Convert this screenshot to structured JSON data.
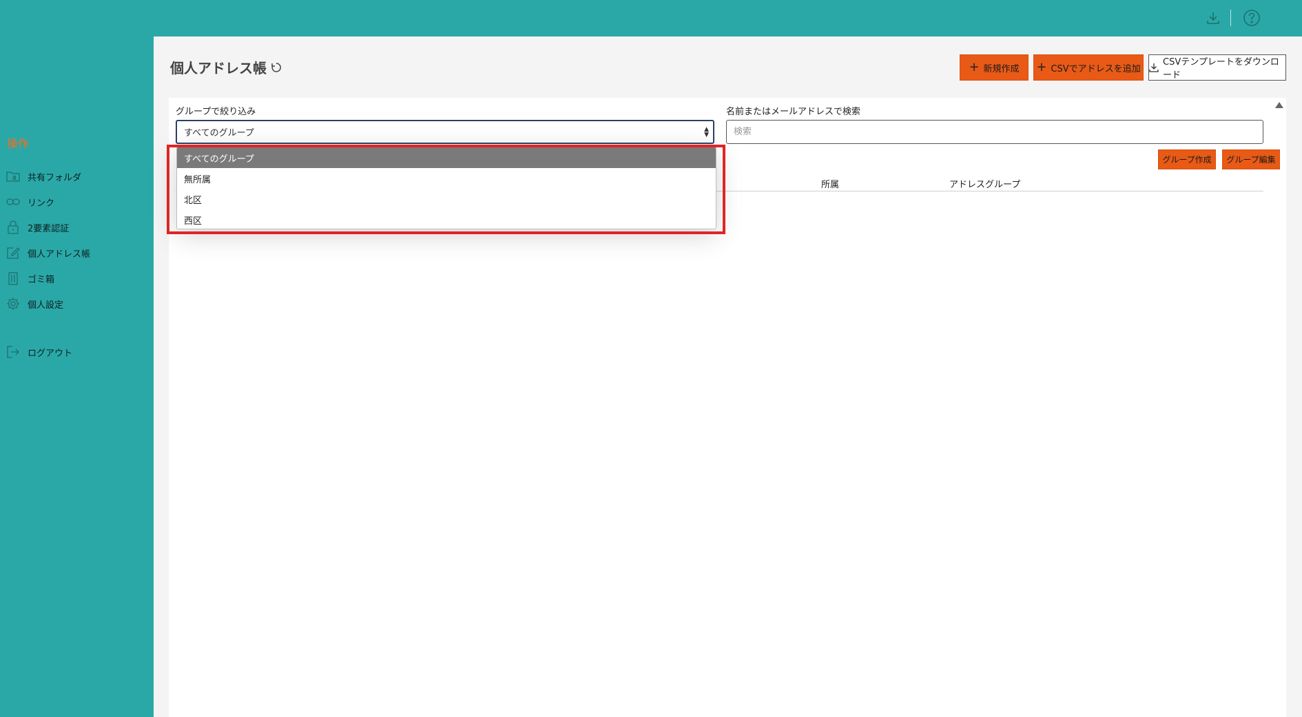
{
  "topbar": {
    "icons": [
      "download-icon",
      "help-icon"
    ]
  },
  "sidebar": {
    "section_title": "操作",
    "items": [
      {
        "label": "共有フォルダ",
        "icon": "shared-folder-icon"
      },
      {
        "label": "リンク",
        "icon": "link-icon"
      },
      {
        "label": "2要素認証",
        "icon": "lock-icon"
      },
      {
        "label": "個人アドレス帳",
        "icon": "address-book-edit-icon"
      },
      {
        "label": "ゴミ箱",
        "icon": "trash-icon"
      },
      {
        "label": "個人設定",
        "icon": "gear-icon"
      }
    ],
    "logout": {
      "label": "ログアウト",
      "icon": "logout-icon"
    }
  },
  "header": {
    "title": "個人アドレス帳",
    "buttons": {
      "new": "新規作成",
      "csv_add": "CSVでアドレスを追加",
      "csv_template": "CSVテンプレートをダウンロード"
    }
  },
  "filter": {
    "group_label": "グループで絞り込み",
    "group_selected": "すべてのグループ",
    "group_options": [
      "すべてのグループ",
      "無所属",
      "北区",
      "西区"
    ],
    "search_label": "名前またはメールアドレスで検索",
    "search_placeholder": "検索",
    "search_value": ""
  },
  "group_buttons": {
    "create": "グループ作成",
    "edit": "グループ編集"
  },
  "table": {
    "headers": [
      "所属",
      "アドレスグループ"
    ]
  },
  "colors": {
    "teal": "#2aa8a8",
    "accent_orange": "#e85a16",
    "section_orange": "#ff6a1a",
    "highlight_red": "#e02424"
  }
}
